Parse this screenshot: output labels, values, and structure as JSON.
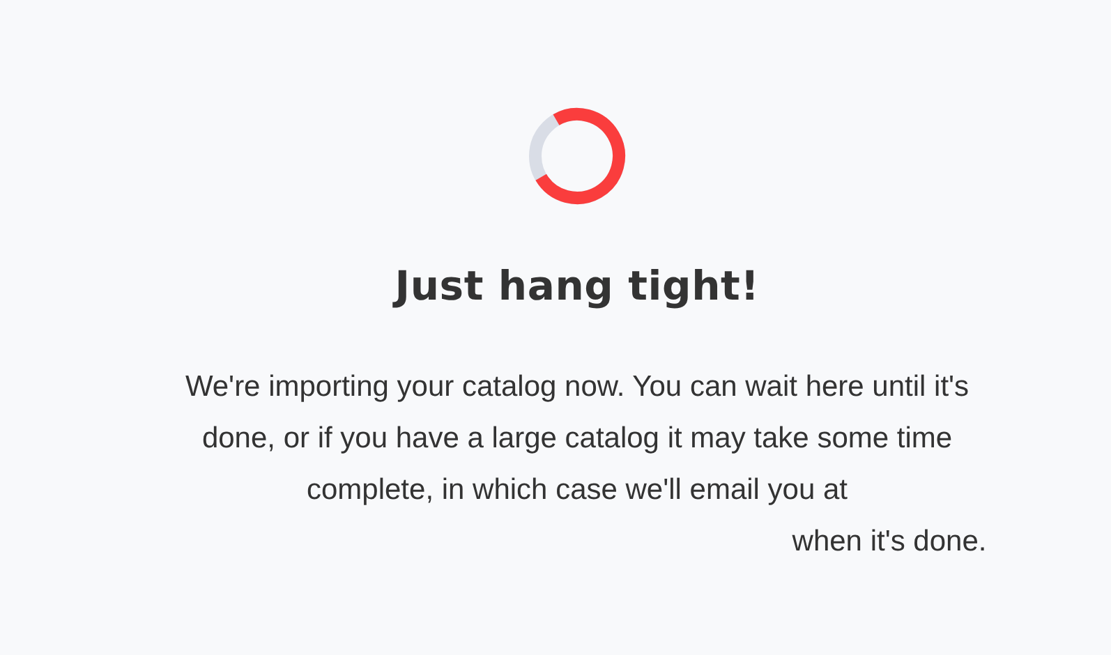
{
  "heading": "Just hang tight!",
  "message_lines": [
    "We're importing your catalog now. You can wait here until it's",
    "done, or if you have a large catalog it may take some time",
    "complete, in which case we'll email you at",
    "when it's done."
  ]
}
